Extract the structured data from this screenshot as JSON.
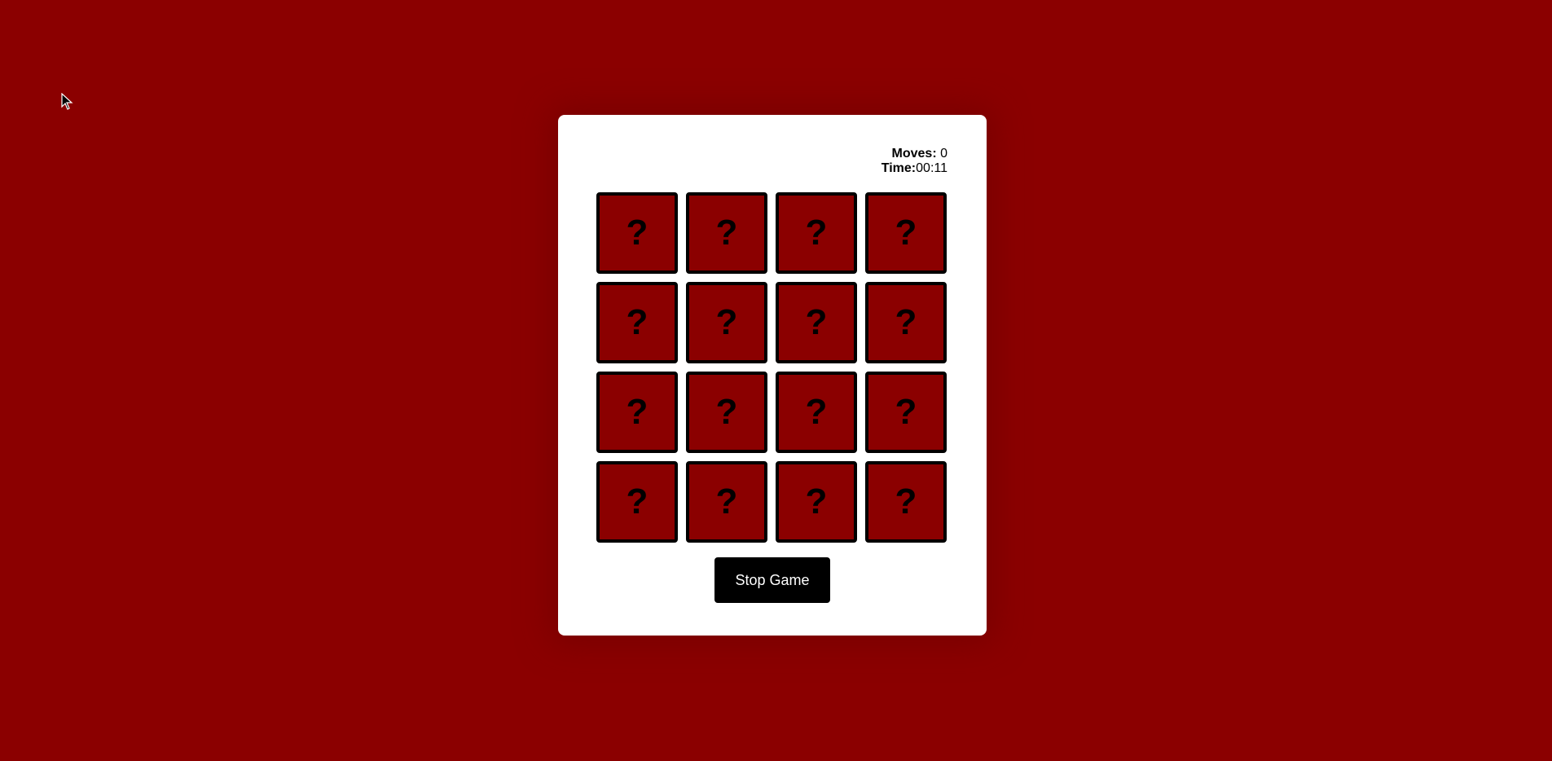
{
  "stats": {
    "moves_label": "Moves:",
    "moves_value": "0",
    "time_label": "Time:",
    "time_value": "00:11"
  },
  "cards": [
    "?",
    "?",
    "?",
    "?",
    "?",
    "?",
    "?",
    "?",
    "?",
    "?",
    "?",
    "?",
    "?",
    "?",
    "?",
    "?"
  ],
  "controls": {
    "stop_label": "Stop Game"
  },
  "colors": {
    "background": "#8b0000",
    "card_back": "#8b0000",
    "panel": "#ffffff",
    "button": "#000000"
  }
}
